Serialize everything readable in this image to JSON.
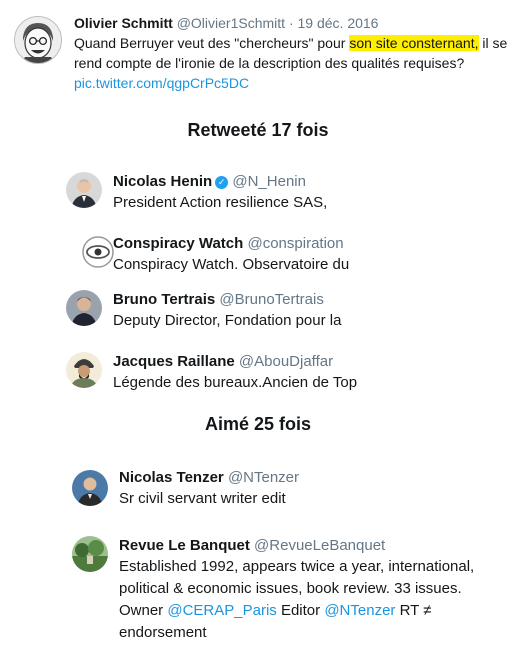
{
  "tweet": {
    "author_name": "Olivier Schmitt",
    "author_handle": "@Olivier1Schmitt",
    "separator": "·",
    "date": "19 déc. 2016",
    "text_before": "Quand Berruyer veut des \"chercheurs\" pour ",
    "text_highlight": "son site consternant,",
    "text_after": " il se rend compte de l'ironie de la description des qualités requises?",
    "link": "pic.twitter.com/qgpCrPc5DC"
  },
  "retweeted": {
    "heading": "Retweeté 17 fois",
    "users": [
      {
        "name": "Nicolas Henin",
        "handle": "@N_Henin",
        "bio": "President Action resilience SAS,",
        "verified": true
      },
      {
        "name": "Conspiracy Watch",
        "handle": "@conspiration",
        "bio": "Conspiracy Watch. Observatoire du"
      },
      {
        "name": "Bruno Tertrais",
        "handle": "@BrunoTertrais",
        "bio": "Deputy Director, Fondation pour la"
      },
      {
        "name": "Jacques Raillane",
        "handle": "@AbouDjaffar",
        "bio": "Légende des bureaux.Ancien de Top"
      }
    ]
  },
  "liked": {
    "heading": "Aimé 25 fois",
    "users": [
      {
        "name": "Nicolas Tenzer",
        "handle": "@NTenzer",
        "bio": "Sr civil servant writer edit"
      },
      {
        "name": "Revue Le Banquet",
        "handle": "@RevueLeBanquet",
        "bio_start": "Established 1992, appears twice a year, international, political & economic issues, book review. 33 issues. Owner ",
        "mention1": "@CERAP_Paris",
        "bio_mid": " Editor ",
        "mention2": "@NTenzer",
        "bio_end": " RT ≠ endorsement"
      }
    ]
  },
  "colors": {
    "link": "#1b95e0",
    "highlight": "#ffee00",
    "verified": "#1da1f2",
    "muted": "#657786"
  },
  "icons": {
    "verified": "verified-badge-icon"
  }
}
